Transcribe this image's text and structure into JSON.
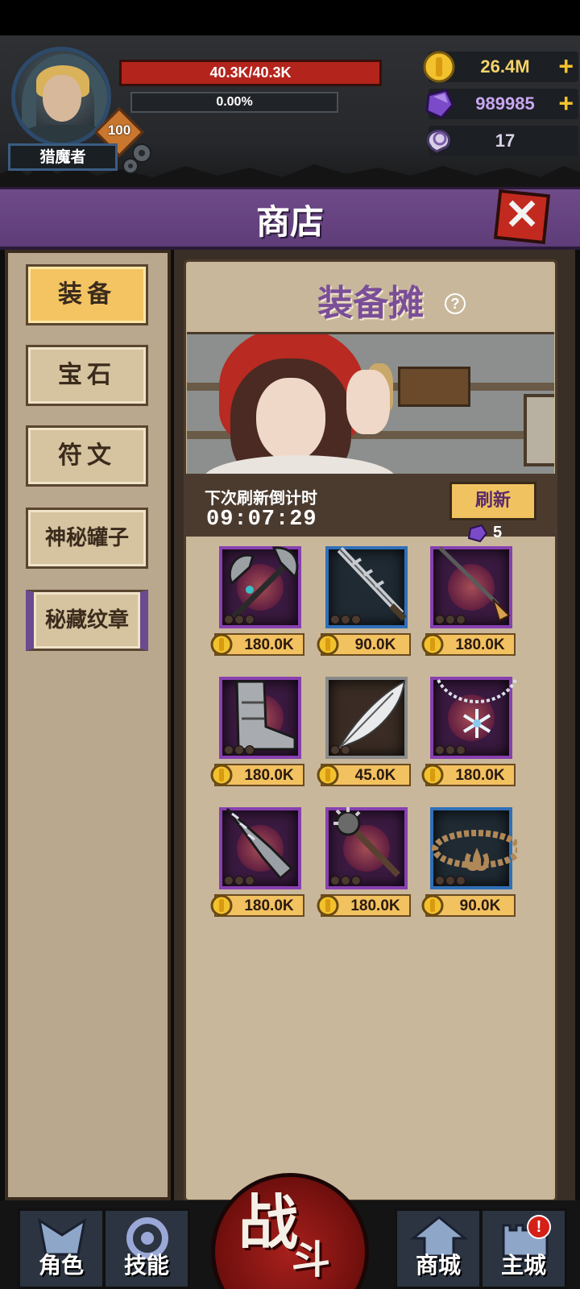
{
  "player": {
    "name": "猎魔者",
    "level": "100",
    "hp": "40.3K/40.3K",
    "xp": "0.00%",
    "xp_progress": 0.0
  },
  "currencies": {
    "gold": "26.4M",
    "crystal": "989985",
    "skull": "17"
  },
  "colors": {
    "accent_purple": "#6f4a8a",
    "gold_button": "#f4c463",
    "hp_red": "#b3241c",
    "epic_border": "#8840b0",
    "rare_border": "#2f6fb8"
  },
  "shop": {
    "title": "商店",
    "close_icon": "close-icon",
    "tabs": [
      {
        "label": "装备",
        "active": true
      },
      {
        "label": "宝石",
        "active": false
      },
      {
        "label": "符文",
        "active": false
      },
      {
        "label": "神秘罐子",
        "active": false
      },
      {
        "label": "秘藏纹章",
        "active": false
      }
    ],
    "stall_title": "装备摊",
    "help": "?",
    "refresh_label": "下次刷新倒计时",
    "countdown": "09:07:29",
    "refresh_button": "刷新",
    "refresh_cost": "5",
    "items": [
      {
        "icon": "battle-axe-icon",
        "rarity": "epic",
        "price": "180.0K"
      },
      {
        "icon": "serrated-sword-icon",
        "rarity": "rare",
        "price": "90.0K"
      },
      {
        "icon": "torch-staff-icon",
        "rarity": "epic",
        "price": "180.0K"
      },
      {
        "icon": "plate-boots-icon",
        "rarity": "epic",
        "price": "180.0K"
      },
      {
        "icon": "feather-icon",
        "rarity": "common",
        "price": "45.0K"
      },
      {
        "icon": "snowflake-necklace-icon",
        "rarity": "epic",
        "price": "180.0K"
      },
      {
        "icon": "spiked-gauntlet-icon",
        "rarity": "epic",
        "price": "180.0K"
      },
      {
        "icon": "spiked-mace-icon",
        "rarity": "epic",
        "price": "180.0K"
      },
      {
        "icon": "rope-belt-icon",
        "rarity": "rare",
        "price": "90.0K"
      }
    ]
  },
  "nav": {
    "character": "角色",
    "skills": "技能",
    "battle_1": "战",
    "battle_2": "斗",
    "store": "商城",
    "city": "主城",
    "city_alert": "!"
  }
}
